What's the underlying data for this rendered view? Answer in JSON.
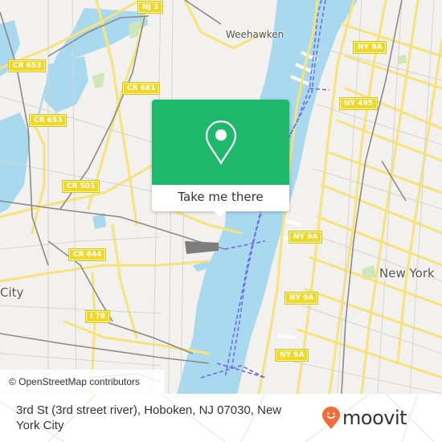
{
  "map": {
    "place_labels": [
      {
        "id": "weehawken",
        "text": "Weehawken"
      },
      {
        "id": "new-york",
        "text": "New York"
      },
      {
        "id": "jersey-city",
        "text": "City"
      }
    ],
    "route_shields": [
      {
        "id": "nj-3",
        "text": "NJ 3"
      },
      {
        "id": "cr-653-a",
        "text": "CR 653"
      },
      {
        "id": "cr-681",
        "text": "CR 681"
      },
      {
        "id": "cr-653-b",
        "text": "CR 653"
      },
      {
        "id": "ny-9a-a",
        "text": "NY 9A"
      },
      {
        "id": "ny-495",
        "text": "NY 495"
      },
      {
        "id": "cr-501",
        "text": "CR 501"
      },
      {
        "id": "cr-644",
        "text": "CR 644"
      },
      {
        "id": "ny-9a-b",
        "text": "NY 9A"
      },
      {
        "id": "ny-9a-c",
        "text": "NY 9A"
      },
      {
        "id": "i-78",
        "text": "I 78"
      },
      {
        "id": "ny-9a-d",
        "text": "NY 9A"
      }
    ],
    "attribution": "© OpenStreetMap contributors",
    "colors": {
      "land": "#f2f1ed",
      "water": "#a9d9ee",
      "road": "#f7e37a",
      "rail": "#8a8a8a",
      "ferry": "#6b6fe6",
      "park": "#cfe6b8"
    }
  },
  "popup": {
    "icon": "map-pin-icon",
    "button_label": "Take me there",
    "accent_color": "#1db86a"
  },
  "footer": {
    "address": "3rd St (3rd street river), Hoboken, NJ 07030, New York City",
    "logo_text": "moovit",
    "logo_color": "#f26b3a"
  }
}
